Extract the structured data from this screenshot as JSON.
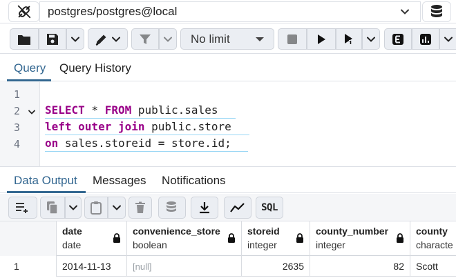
{
  "connection": {
    "label": "postgres/postgres@local"
  },
  "toolbar": {
    "limit_label": "No limit"
  },
  "query_tabs": [
    {
      "label": "Query",
      "active": true
    },
    {
      "label": "Query History",
      "active": false
    }
  ],
  "editor": {
    "line_numbers": [
      "1",
      "2",
      "3",
      "4"
    ],
    "lines": [
      {
        "kw": "",
        "rest": ""
      },
      {
        "kw": "SELECT",
        "mid": " * ",
        "kw2": "FROM",
        "rest": " public.sales"
      },
      {
        "kw": "left outer join",
        "rest": " public.store"
      },
      {
        "kw": "on",
        "rest": " sales.storeid = store.id;"
      }
    ]
  },
  "result_tabs": [
    {
      "label": "Data Output",
      "active": true
    },
    {
      "label": "Messages",
      "active": false
    },
    {
      "label": "Notifications",
      "active": false
    }
  ],
  "results_toolbar": {
    "sql_label": "SQL"
  },
  "grid": {
    "columns": [
      {
        "name": "date",
        "type": "date"
      },
      {
        "name": "convenience_store",
        "type": "boolean"
      },
      {
        "name": "storeid",
        "type": "integer"
      },
      {
        "name": "county_number",
        "type": "integer"
      },
      {
        "name": "county",
        "type": "characte"
      }
    ],
    "rows": [
      {
        "row_number": "1",
        "cells": [
          "2014-11-13",
          "[null]",
          "2635",
          "82",
          "Scott"
        ]
      }
    ]
  },
  "colors": {
    "accent": "#326690",
    "keyword": "#990088",
    "null_text": "#9aa0a6"
  }
}
